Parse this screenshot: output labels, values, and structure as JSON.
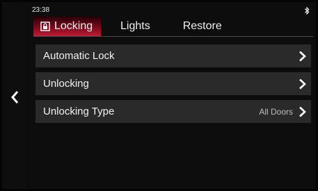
{
  "status": {
    "time": "23:38",
    "bluetooth_icon": "bluetooth-icon"
  },
  "navigation": {
    "back_icon": "chevron-left-icon"
  },
  "tabs": [
    {
      "label": "Locking",
      "icon": "lock-icon",
      "active": true
    },
    {
      "label": "Lights",
      "active": false
    },
    {
      "label": "Restore",
      "active": false
    }
  ],
  "menu": {
    "items": [
      {
        "label": "Automatic Lock",
        "value": "",
        "icon": "chevron-right-icon"
      },
      {
        "label": "Unlocking",
        "value": "",
        "icon": "chevron-right-icon"
      },
      {
        "label": "Unlocking Type",
        "value": "All Doors",
        "icon": "chevron-right-icon"
      }
    ]
  },
  "colors": {
    "active_tab": "#c21a36",
    "row_background": "#2a2a2a",
    "screen_background": "#0d0d0d"
  }
}
